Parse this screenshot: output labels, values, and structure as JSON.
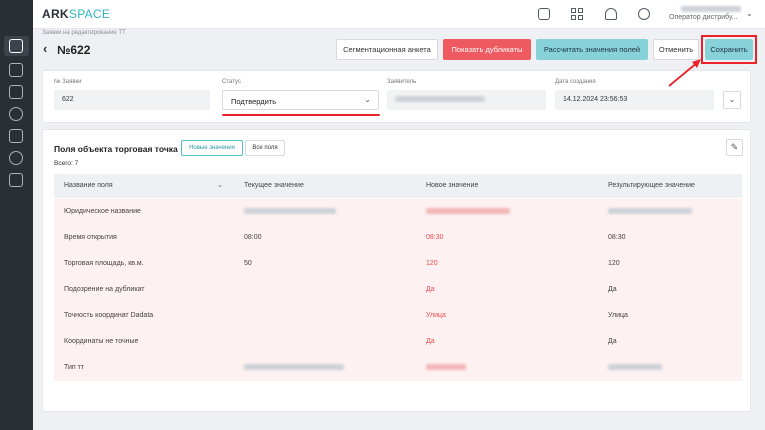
{
  "app": {
    "logo_ark": "ARK",
    "logo_space": "SPACE"
  },
  "header": {
    "user_role": "Оператор дистрибу..."
  },
  "page": {
    "breadcrumb": "Заявки на редактирование ТТ",
    "title": "№622"
  },
  "toolbar": {
    "segmentation": "Сегментационная анкета",
    "show_duplicates": "Показать дубликаты",
    "calculate": "Рассчитать значения полей",
    "cancel": "Отменить",
    "save": "Сохранить"
  },
  "form": {
    "request_no_label": "№ Заявки",
    "request_no_value": "622",
    "status_label": "Статус",
    "status_value": "Подтвердить",
    "applicant_label": "Заявитель",
    "created_label": "Дата создания",
    "created_value": "14.12.2024 23:56:53"
  },
  "section": {
    "title": "Поля объекта торговая точка",
    "tab_new": "Новые значения",
    "tab_all": "Все поля",
    "total": "Всего: 7"
  },
  "table": {
    "headers": [
      "Название поля",
      "Текущее значение",
      "Новое значение",
      "Результирующее значение"
    ],
    "rows": [
      {
        "name": "Юридическое название",
        "current": "",
        "new": "",
        "result": ""
      },
      {
        "name": "Время открытия",
        "current": "08:00",
        "new": "08:30",
        "result": "08:30"
      },
      {
        "name": "Торговая площадь, кв.м.",
        "current": "50",
        "new": "120",
        "result": "120"
      },
      {
        "name": "Подозрение на дубликат",
        "current": "",
        "new": "Да",
        "result": "Да"
      },
      {
        "name": "Точность координат Dadata",
        "current": "",
        "new": "Улица",
        "result": "Улица"
      },
      {
        "name": "Координаты не точные",
        "current": "",
        "new": "Да",
        "result": "Да"
      },
      {
        "name": "Тип тт",
        "current": "",
        "new": "",
        "result": ""
      }
    ]
  },
  "colors": {
    "accent": "#4cc0c8",
    "danger": "#ee5a5f",
    "highlight": "#e8242a"
  }
}
